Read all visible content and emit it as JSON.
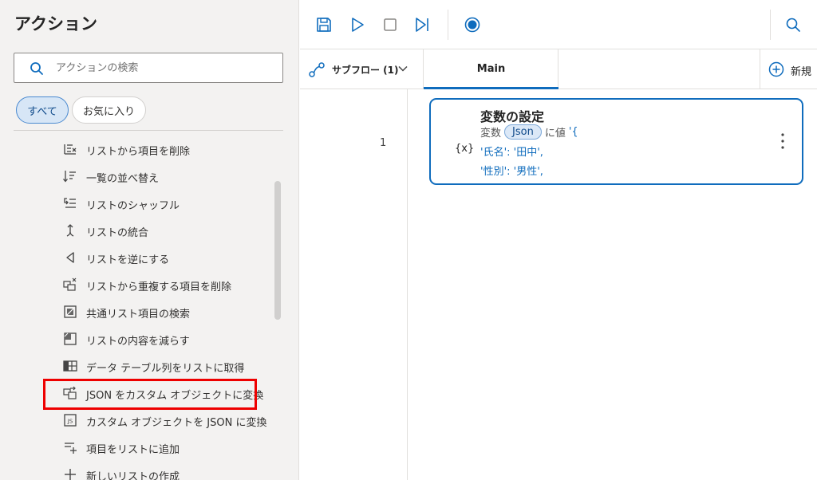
{
  "left_panel": {
    "title": "アクション",
    "search_placeholder": "アクションの検索",
    "filters": {
      "all": "すべて",
      "favorites": "お気に入り"
    },
    "actions": [
      {
        "label": "リストから項目を削除",
        "icon": "list-remove-icon"
      },
      {
        "label": "一覧の並べ替え",
        "icon": "sort-icon"
      },
      {
        "label": "リストのシャッフル",
        "icon": "shuffle-icon"
      },
      {
        "label": "リストの統合",
        "icon": "merge-icon"
      },
      {
        "label": "リストを逆にする",
        "icon": "reverse-icon"
      },
      {
        "label": "リストから重複する項目を削除",
        "icon": "remove-duplicates-icon"
      },
      {
        "label": "共通リスト項目の検索",
        "icon": "common-items-icon"
      },
      {
        "label": "リストの内容を減らす",
        "icon": "subtract-list-icon"
      },
      {
        "label": "データ テーブル列をリストに取得",
        "icon": "table-column-icon"
      },
      {
        "label": "JSON をカスタム オブジェクトに変換",
        "icon": "json-to-object-icon"
      },
      {
        "label": "カスタム オブジェクトを JSON に変換",
        "icon": "object-to-json-icon"
      },
      {
        "label": "項目をリストに追加",
        "icon": "add-item-icon"
      },
      {
        "label": "新しいリストの作成",
        "icon": "new-list-icon"
      }
    ],
    "highlighted_action": "JSON をカスタム オブジェクトに変換"
  },
  "tabs": {
    "subflows": "サブフロー (1)",
    "main": "Main",
    "new": "新規"
  },
  "flow": {
    "line_number": "1",
    "step": {
      "icon_text": "{x}",
      "title": "変数の設定",
      "prefix": "変数",
      "variable": "Json",
      "value_label": "に値",
      "value_line0": "'{",
      "value_line1": "'氏名': '田中',",
      "value_line2": "'性別': '男性',"
    }
  },
  "colors": {
    "accent": "#0f6cbd",
    "highlight": "#e00000"
  }
}
